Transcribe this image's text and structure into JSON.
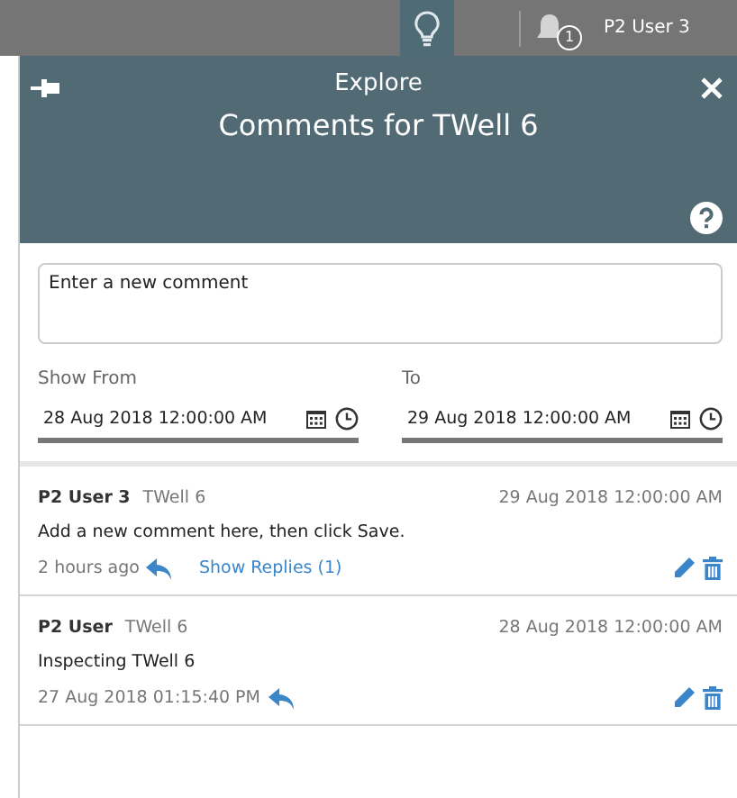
{
  "top_bar": {
    "notification_count": "1",
    "user": "P2 User 3"
  },
  "panel": {
    "subtitle": "Explore",
    "title": "Comments for TWell 6"
  },
  "comment_field": {
    "placeholder": "Enter a new comment"
  },
  "filters": [
    {
      "label": "Show From",
      "value": "28 Aug 2018 12:00:00 AM"
    },
    {
      "label": "To",
      "value": "29 Aug 2018 12:00:00 AM"
    }
  ],
  "comments": [
    {
      "author": "P2 User 3",
      "subject": "TWell 6",
      "date": "29 Aug 2018 12:00:00 AM",
      "text": "Add a new comment here, then click Save.",
      "time": "2 hours ago",
      "replies_link": "Show Replies (1)"
    },
    {
      "author": "P2 User",
      "subject": "TWell 6",
      "date": "28 Aug 2018 12:00:00 AM",
      "text": "Inspecting TWell 6",
      "time": "27 Aug 2018 01:15:40 PM"
    }
  ]
}
